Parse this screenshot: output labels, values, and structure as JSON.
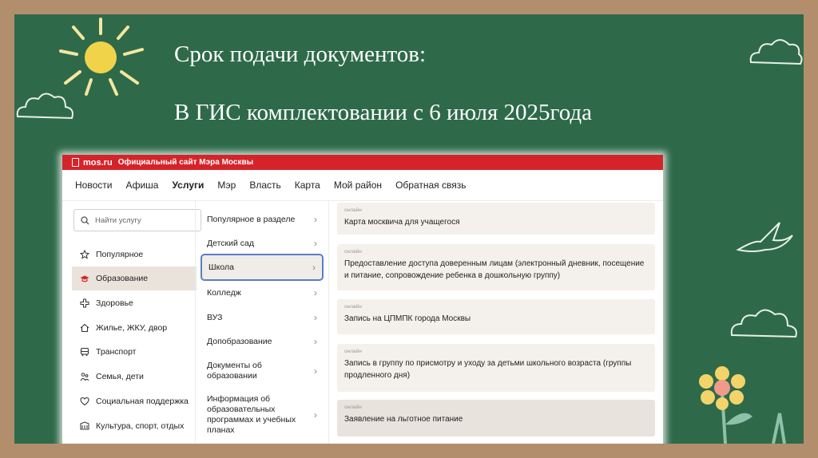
{
  "slide": {
    "title_line1": "Срок подачи документов:",
    "title_line2": "В ГИС комплектовании с 6 июля 2025года"
  },
  "site": {
    "brand": "mos.ru",
    "official": "Официальный сайт Мэра Москвы",
    "nav": [
      "Новости",
      "Афиша",
      "Услуги",
      "Мэр",
      "Власть",
      "Карта",
      "Мой район",
      "Обратная связь"
    ],
    "nav_active": "Услуги",
    "search_placeholder": "Найти услугу",
    "categories": [
      {
        "label": "Популярное",
        "icon": "star-icon"
      },
      {
        "label": "Образование",
        "icon": "graduation-cap-icon",
        "active": true
      },
      {
        "label": "Здоровье",
        "icon": "health-cross-icon"
      },
      {
        "label": "Жилье, ЖКУ, двор",
        "icon": "house-icon"
      },
      {
        "label": "Транспорт",
        "icon": "bus-icon"
      },
      {
        "label": "Семья, дети",
        "icon": "family-icon"
      },
      {
        "label": "Социальная поддержка",
        "icon": "support-icon"
      },
      {
        "label": "Культура, спорт, отдых",
        "icon": "culture-icon"
      }
    ],
    "subcategories": [
      "Популярное в разделе",
      "Детский сад",
      "Школа",
      "Колледж",
      "ВУЗ",
      "Допобразование",
      "Документы об образовании",
      "Информация об образовательных программах и учебных планах"
    ],
    "sub_active": "Школа",
    "badge": "онлайн",
    "services": [
      "Карта москвича для учащегося",
      "Предоставление доступа доверенным лицам (электронный дневник, посещение и питание, сопровождение ребенка в дошкольную группу)",
      "Запись на ЦПМПК города Москвы",
      "Запись в группу по присмотру и уходу за детьми школьного возраста (группы продленного дня)",
      "Заявление на льготное питание"
    ]
  },
  "colors": {
    "board": "#2e6a49",
    "frame": "#b28e6d",
    "accent": "#d5232a",
    "active_border": "#5a7fc9"
  }
}
